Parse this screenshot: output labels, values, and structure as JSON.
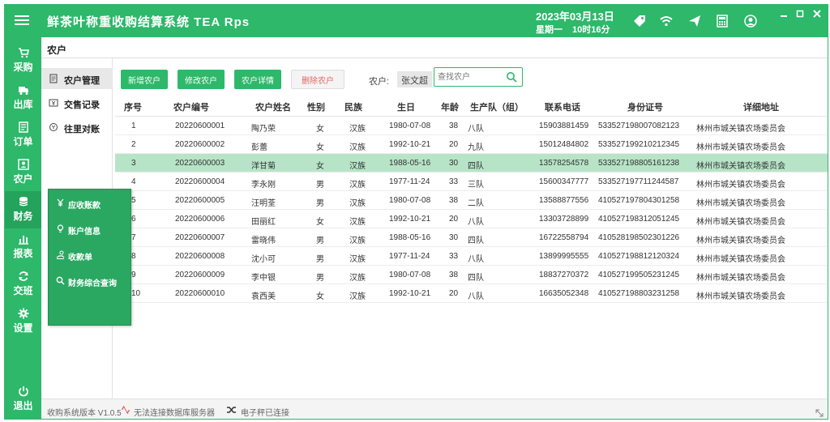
{
  "app": {
    "title": "鲜茶叶称重收购结算系统  TEA  Rps",
    "date": "2023年03月13日",
    "weekday": "星期一",
    "time": "10时16分"
  },
  "sidebar": {
    "items": [
      {
        "label": "采购",
        "icon": "cart-icon"
      },
      {
        "label": "出库",
        "icon": "truck-icon"
      },
      {
        "label": "订单",
        "icon": "order-icon"
      },
      {
        "label": "农户",
        "icon": "farmer-icon"
      },
      {
        "label": "财务",
        "icon": "database-icon"
      },
      {
        "label": "报表",
        "icon": "bar-chart-icon"
      },
      {
        "label": "交班",
        "icon": "refresh-icon"
      },
      {
        "label": "设置",
        "icon": "gear-icon"
      },
      {
        "label": "退出",
        "icon": "power-icon"
      }
    ]
  },
  "breadcrumb": "农户",
  "subnav": {
    "items": [
      {
        "label": "农户管理",
        "icon": "document-icon"
      },
      {
        "label": "交售记录",
        "icon": "yen-card-icon"
      },
      {
        "label": "往里对账",
        "icon": "reconcile-icon"
      }
    ]
  },
  "toolbar": {
    "add": "新增农户",
    "edit": "修改农户",
    "detail": "农户详情",
    "delete": "删除农户",
    "farmer_label": "农户:",
    "farmer_name": "张文超",
    "search_placeholder": "查找农户"
  },
  "table": {
    "headers": [
      "序号",
      "农户编号",
      "农户姓名",
      "性别",
      "民族",
      "生日",
      "年龄",
      "生产队（组）",
      "联系电话",
      "身份证号",
      "详细地址"
    ],
    "rows": [
      [
        "1",
        "20220600001",
        "陶乃荣",
        "女",
        "汉族",
        "1980-07-08",
        "38",
        "八队",
        "15903881459",
        "533527198007082123",
        "林州市城关镇农场委员会"
      ],
      [
        "2",
        "20220600002",
        "彭蕾",
        "女",
        "汉族",
        "1992-10-21",
        "20",
        "九队",
        "15012484802",
        "533527199210212345",
        "林州市城关镇农场委员会"
      ],
      [
        "3",
        "20220600003",
        "洋甘菊",
        "女",
        "汉族",
        "1988-05-16",
        "30",
        "四队",
        "13578254578",
        "533527198805161238",
        "林州市城关镇农场委员会"
      ],
      [
        "4",
        "20220600004",
        "李永刚",
        "男",
        "汉族",
        "1977-11-24",
        "33",
        "三队",
        "15600347777",
        "533527197711244587",
        "林州市城关镇农场委员会"
      ],
      [
        "5",
        "20220600005",
        "汪明荃",
        "男",
        "汉族",
        "1980-07-08",
        "38",
        "二队",
        "13588877556",
        "410527197804301258",
        "林州市城关镇农场委员会"
      ],
      [
        "6",
        "20220600006",
        "田丽红",
        "女",
        "汉族",
        "1992-10-21",
        "20",
        "八队",
        "13303728899",
        "410527198312051245",
        "林州市城关镇农场委员会"
      ],
      [
        "7",
        "20220600007",
        "雷晓伟",
        "男",
        "汉族",
        "1988-05-16",
        "30",
        "四队",
        "16722558794",
        "410528198502301226",
        "林州市城关镇农场委员会"
      ],
      [
        "8",
        "20220600008",
        "沈小可",
        "男",
        "汉族",
        "1977-11-24",
        "33",
        "八队",
        "13899995555",
        "410527198812120324",
        "林州市城关镇农场委员会"
      ],
      [
        "9",
        "20220600009",
        "李中银",
        "男",
        "汉族",
        "1980-07-08",
        "38",
        "四队",
        "18837270372",
        "410527199505231245",
        "林州市城关镇农场委员会"
      ],
      [
        "10",
        "20220600010",
        "袁西美",
        "女",
        "汉族",
        "1992-10-21",
        "20",
        "八队",
        "16635052348",
        "410527198803231258",
        "林州市城关镇农场委员会"
      ]
    ],
    "selected_row": 3
  },
  "finance_menu": {
    "items": [
      {
        "label": "应收账款",
        "icon": "yen-icon"
      },
      {
        "label": "账户信息",
        "icon": "lightbulb-icon"
      },
      {
        "label": "收款单",
        "icon": "hand-coin-icon"
      },
      {
        "label": "财务综合查询",
        "icon": "search-icon"
      }
    ]
  },
  "status": {
    "version": "收购系统版本 V1.0.5",
    "db": "无法连接数据库服务器",
    "scale": "电子秤已连接"
  },
  "colors": {
    "brand": "#2db86a",
    "selected_row": "#b7e4c7",
    "danger_text": "#e06666"
  }
}
